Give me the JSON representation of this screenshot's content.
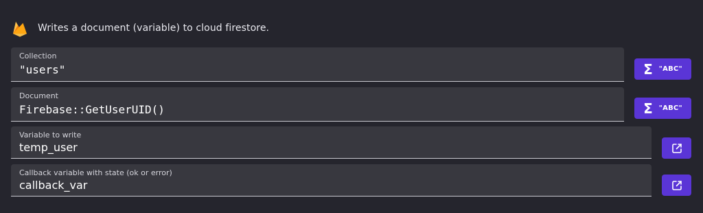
{
  "header": {
    "icon": "firebase-icon",
    "description": "Writes a document (variable) to cloud firestore."
  },
  "fields": [
    {
      "label": "Collection",
      "value": "\"users\"",
      "action": {
        "icon": "sigma-icon",
        "label": "\"ABC\""
      }
    },
    {
      "label": "Document",
      "value": "Firebase::GetUserUID()",
      "action": {
        "icon": "sigma-icon",
        "label": "\"ABC\""
      }
    },
    {
      "label": "Variable to write",
      "value": "temp_user",
      "action": {
        "icon": "open-external-icon"
      }
    },
    {
      "label": "Callback variable with state (ok or error)",
      "value": "callback_var",
      "action": {
        "icon": "open-external-icon"
      }
    }
  ],
  "colors": {
    "background": "#25252d",
    "field": "#38383f",
    "accent": "#5a35d6"
  }
}
